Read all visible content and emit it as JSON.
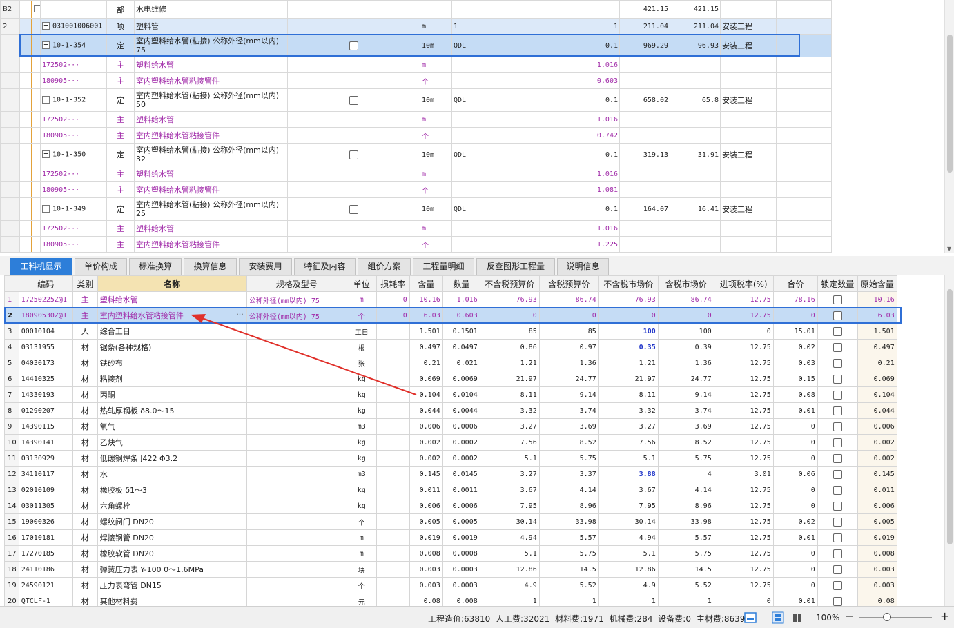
{
  "top_rows": [
    {
      "rowno": "B2",
      "kind": "section",
      "code": "",
      "type": "部",
      "name": "水电维修",
      "unit": "",
      "expr": "",
      "qty": "",
      "price": "421.15",
      "total": "421.15",
      "cat": ""
    },
    {
      "rowno": "2",
      "kind": "xiang",
      "code": "031001006001",
      "type": "项",
      "name": "塑料管",
      "unit": "m",
      "expr": "1",
      "qty": "1",
      "price": "211.04",
      "total": "211.04",
      "cat": "安装工程"
    },
    {
      "rowno": "",
      "kind": "ding",
      "code": "10-1-354",
      "type": "定",
      "name": "室内塑料给水管(粘接) 公称外径(mm以内) 75",
      "unit": "10m",
      "expr": "QDL",
      "qty": "0.1",
      "price": "969.29",
      "total": "96.93",
      "cat": "安装工程",
      "selected": true
    },
    {
      "rowno": "",
      "kind": "main",
      "code": "172502···",
      "type": "主",
      "name": "塑料给水管",
      "unit": "m",
      "expr": "",
      "qty": "1.016",
      "price": "",
      "total": "",
      "cat": ""
    },
    {
      "rowno": "",
      "kind": "main",
      "code": "180905···",
      "type": "主",
      "name": "室内塑料给水管粘接管件",
      "unit": "个",
      "expr": "",
      "qty": "0.603",
      "price": "",
      "total": "",
      "cat": ""
    },
    {
      "rowno": "",
      "kind": "ding",
      "code": "10-1-352",
      "type": "定",
      "name": "室内塑料给水管(粘接) 公称外径(mm以内) 50",
      "unit": "10m",
      "expr": "QDL",
      "qty": "0.1",
      "price": "658.02",
      "total": "65.8",
      "cat": "安装工程"
    },
    {
      "rowno": "",
      "kind": "main",
      "code": "172502···",
      "type": "主",
      "name": "塑料给水管",
      "unit": "m",
      "expr": "",
      "qty": "1.016",
      "price": "",
      "total": "",
      "cat": ""
    },
    {
      "rowno": "",
      "kind": "main",
      "code": "180905···",
      "type": "主",
      "name": "室内塑料给水管粘接管件",
      "unit": "个",
      "expr": "",
      "qty": "0.742",
      "price": "",
      "total": "",
      "cat": ""
    },
    {
      "rowno": "",
      "kind": "ding",
      "code": "10-1-350",
      "type": "定",
      "name": "室内塑料给水管(粘接) 公称外径(mm以内) 32",
      "unit": "10m",
      "expr": "QDL",
      "qty": "0.1",
      "price": "319.13",
      "total": "31.91",
      "cat": "安装工程"
    },
    {
      "rowno": "",
      "kind": "main",
      "code": "172502···",
      "type": "主",
      "name": "塑料给水管",
      "unit": "m",
      "expr": "",
      "qty": "1.016",
      "price": "",
      "total": "",
      "cat": ""
    },
    {
      "rowno": "",
      "kind": "main",
      "code": "180905···",
      "type": "主",
      "name": "室内塑料给水管粘接管件",
      "unit": "个",
      "expr": "",
      "qty": "1.081",
      "price": "",
      "total": "",
      "cat": ""
    },
    {
      "rowno": "",
      "kind": "ding",
      "code": "10-1-349",
      "type": "定",
      "name": "室内塑料给水管(粘接) 公称外径(mm以内) 25",
      "unit": "10m",
      "expr": "QDL",
      "qty": "0.1",
      "price": "164.07",
      "total": "16.41",
      "cat": "安装工程"
    },
    {
      "rowno": "",
      "kind": "main",
      "code": "172502···",
      "type": "主",
      "name": "塑料给水管",
      "unit": "m",
      "expr": "",
      "qty": "1.016",
      "price": "",
      "total": "",
      "cat": ""
    },
    {
      "rowno": "",
      "kind": "main",
      "code": "180905···",
      "type": "主",
      "name": "室内塑料给水管粘接管件",
      "unit": "个",
      "expr": "",
      "qty": "1.225",
      "price": "",
      "total": "",
      "cat": ""
    }
  ],
  "tabs": [
    "工料机显示",
    "单价构成",
    "标准换算",
    "换算信息",
    "安装费用",
    "特征及内容",
    "组价方案",
    "工程量明细",
    "反查图形工程量",
    "说明信息"
  ],
  "bottom_headers": [
    "",
    "编码",
    "类别",
    "名称",
    "规格及型号",
    "单位",
    "损耗率",
    "含量",
    "数量",
    "不含税预算价",
    "含税预算价",
    "不含税市场价",
    "含税市场价",
    "进项税率(%)",
    "合价",
    "锁定数量",
    "原始含量"
  ],
  "bottom_rows": [
    {
      "no": "1",
      "code": "17250225Z@1",
      "type": "主",
      "name": "塑料给水管",
      "spec": "公称外径(mm以内) 75",
      "unit": "m",
      "loss": "0",
      "content": "10.16",
      "qty": "1.016",
      "p1": "76.93",
      "p2": "86.74",
      "p3": "76.93",
      "p4": "86.74",
      "tax": "12.75",
      "total": "78.16",
      "orig": "10.16"
    },
    {
      "no": "2",
      "code": "18090530Z@1",
      "type": "主",
      "name": "室内塑料给水管粘接管件",
      "spec": "公称外径(mm以内) 75",
      "unit": "个",
      "loss": "0",
      "content": "6.03",
      "qty": "0.603",
      "p1": "0",
      "p2": "0",
      "p3": "0",
      "p4": "0",
      "tax": "12.75",
      "total": "0",
      "orig": "6.03"
    },
    {
      "no": "3",
      "code": "00010104",
      "type": "人",
      "name": "综合工日",
      "spec": "",
      "unit": "工日",
      "loss": "",
      "content": "1.501",
      "qty": "0.1501",
      "p1": "85",
      "p2": "85",
      "p3": "100",
      "p4": "100",
      "tax": "0",
      "total": "15.01",
      "orig": "1.501",
      "p3_hl": true
    },
    {
      "no": "4",
      "code": "03131955",
      "type": "材",
      "name": "锯条(各种规格)",
      "spec": "",
      "unit": "根",
      "loss": "",
      "content": "0.497",
      "qty": "0.0497",
      "p1": "0.86",
      "p2": "0.97",
      "p3": "0.35",
      "p4": "0.39",
      "tax": "12.75",
      "total": "0.02",
      "orig": "0.497",
      "p3_hl": true
    },
    {
      "no": "5",
      "code": "04030173",
      "type": "材",
      "name": "铁砂布",
      "spec": "",
      "unit": "张",
      "loss": "",
      "content": "0.21",
      "qty": "0.021",
      "p1": "1.21",
      "p2": "1.36",
      "p3": "1.21",
      "p4": "1.36",
      "tax": "12.75",
      "total": "0.03",
      "orig": "0.21"
    },
    {
      "no": "6",
      "code": "14410325",
      "type": "材",
      "name": "粘接剂",
      "spec": "",
      "unit": "kg",
      "loss": "",
      "content": "0.069",
      "qty": "0.0069",
      "p1": "21.97",
      "p2": "24.77",
      "p3": "21.97",
      "p4": "24.77",
      "tax": "12.75",
      "total": "0.15",
      "orig": "0.069"
    },
    {
      "no": "7",
      "code": "14330193",
      "type": "材",
      "name": "丙酮",
      "spec": "",
      "unit": "kg",
      "loss": "",
      "content": "0.104",
      "qty": "0.0104",
      "p1": "8.11",
      "p2": "9.14",
      "p3": "8.11",
      "p4": "9.14",
      "tax": "12.75",
      "total": "0.08",
      "orig": "0.104"
    },
    {
      "no": "8",
      "code": "01290207",
      "type": "材",
      "name": "热轧厚钢板 δ8.0～15",
      "spec": "",
      "unit": "kg",
      "loss": "",
      "content": "0.044",
      "qty": "0.0044",
      "p1": "3.32",
      "p2": "3.74",
      "p3": "3.32",
      "p4": "3.74",
      "tax": "12.75",
      "total": "0.01",
      "orig": "0.044"
    },
    {
      "no": "9",
      "code": "14390115",
      "type": "材",
      "name": "氧气",
      "spec": "",
      "unit": "m3",
      "loss": "",
      "content": "0.006",
      "qty": "0.0006",
      "p1": "3.27",
      "p2": "3.69",
      "p3": "3.27",
      "p4": "3.69",
      "tax": "12.75",
      "total": "0",
      "orig": "0.006"
    },
    {
      "no": "10",
      "code": "14390141",
      "type": "材",
      "name": "乙炔气",
      "spec": "",
      "unit": "kg",
      "loss": "",
      "content": "0.002",
      "qty": "0.0002",
      "p1": "7.56",
      "p2": "8.52",
      "p3": "7.56",
      "p4": "8.52",
      "tax": "12.75",
      "total": "0",
      "orig": "0.002"
    },
    {
      "no": "11",
      "code": "03130929",
      "type": "材",
      "name": "低碳钢焊条 J422 Φ3.2",
      "spec": "",
      "unit": "kg",
      "loss": "",
      "content": "0.002",
      "qty": "0.0002",
      "p1": "5.1",
      "p2": "5.75",
      "p3": "5.1",
      "p4": "5.75",
      "tax": "12.75",
      "total": "0",
      "orig": "0.002"
    },
    {
      "no": "12",
      "code": "34110117",
      "type": "材",
      "name": "水",
      "spec": "",
      "unit": "m3",
      "loss": "",
      "content": "0.145",
      "qty": "0.0145",
      "p1": "3.27",
      "p2": "3.37",
      "p3": "3.88",
      "p4": "4",
      "tax": "3.01",
      "total": "0.06",
      "orig": "0.145",
      "p3_hl": true
    },
    {
      "no": "13",
      "code": "02010109",
      "type": "材",
      "name": "橡胶板 δ1～3",
      "spec": "",
      "unit": "kg",
      "loss": "",
      "content": "0.011",
      "qty": "0.0011",
      "p1": "3.67",
      "p2": "4.14",
      "p3": "3.67",
      "p4": "4.14",
      "tax": "12.75",
      "total": "0",
      "orig": "0.011"
    },
    {
      "no": "14",
      "code": "03011305",
      "type": "材",
      "name": "六角螺栓",
      "spec": "",
      "unit": "kg",
      "loss": "",
      "content": "0.006",
      "qty": "0.0006",
      "p1": "7.95",
      "p2": "8.96",
      "p3": "7.95",
      "p4": "8.96",
      "tax": "12.75",
      "total": "0",
      "orig": "0.006"
    },
    {
      "no": "15",
      "code": "19000326",
      "type": "材",
      "name": "螺纹阀门 DN20",
      "spec": "",
      "unit": "个",
      "loss": "",
      "content": "0.005",
      "qty": "0.0005",
      "p1": "30.14",
      "p2": "33.98",
      "p3": "30.14",
      "p4": "33.98",
      "tax": "12.75",
      "total": "0.02",
      "orig": "0.005"
    },
    {
      "no": "16",
      "code": "17010181",
      "type": "材",
      "name": "焊接钢管 DN20",
      "spec": "",
      "unit": "m",
      "loss": "",
      "content": "0.019",
      "qty": "0.0019",
      "p1": "4.94",
      "p2": "5.57",
      "p3": "4.94",
      "p4": "5.57",
      "tax": "12.75",
      "total": "0.01",
      "orig": "0.019"
    },
    {
      "no": "17",
      "code": "17270185",
      "type": "材",
      "name": "橡胶软管 DN20",
      "spec": "",
      "unit": "m",
      "loss": "",
      "content": "0.008",
      "qty": "0.0008",
      "p1": "5.1",
      "p2": "5.75",
      "p3": "5.1",
      "p4": "5.75",
      "tax": "12.75",
      "total": "0",
      "orig": "0.008"
    },
    {
      "no": "18",
      "code": "24110186",
      "type": "材",
      "name": "弹簧压力表 Y-100 0～1.6MPa",
      "spec": "",
      "unit": "块",
      "loss": "",
      "content": "0.003",
      "qty": "0.0003",
      "p1": "12.86",
      "p2": "14.5",
      "p3": "12.86",
      "p4": "14.5",
      "tax": "12.75",
      "total": "0",
      "orig": "0.003"
    },
    {
      "no": "19",
      "code": "24590121",
      "type": "材",
      "name": "压力表弯管 DN15",
      "spec": "",
      "unit": "个",
      "loss": "",
      "content": "0.003",
      "qty": "0.0003",
      "p1": "4.9",
      "p2": "5.52",
      "p3": "4.9",
      "p4": "5.52",
      "tax": "12.75",
      "total": "0",
      "orig": "0.003"
    },
    {
      "no": "20",
      "code": "QTCLF-1",
      "type": "材",
      "name": "其他材料费",
      "spec": "",
      "unit": "元",
      "loss": "",
      "content": "0.08",
      "qty": "0.008",
      "p1": "1",
      "p2": "1",
      "p3": "1",
      "p4": "1",
      "tax": "0",
      "total": "0.01",
      "orig": "0.08"
    }
  ],
  "status": {
    "cost": "工程造价:63810",
    "labor": "人工费:32021",
    "material": "材料费:1971",
    "machine": "机械费:284",
    "equipment": "设备费:0",
    "main_material": "主材费:8639",
    "zoom": "100%",
    "zoom_minus": "−",
    "zoom_plus": "+"
  },
  "colors": {
    "accent": "#2d7ed9",
    "purple": "#a02aa8",
    "highlight_blue": "#1f34c8",
    "arrow_red": "#e0302a"
  }
}
